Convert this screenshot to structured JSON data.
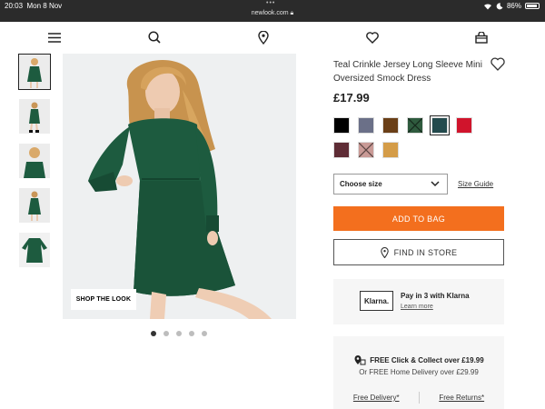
{
  "status_bar": {
    "time": "20:03",
    "date": "Mon 8 Nov",
    "url": "newlook.com",
    "battery": "86%"
  },
  "nav": {
    "icons": [
      "menu-icon",
      "search-icon",
      "location-icon",
      "heart-icon",
      "bag-icon"
    ]
  },
  "gallery": {
    "shop_the_look": "SHOP THE LOOK",
    "thumbnail_count": 5,
    "active_thumbnail": 0,
    "page_count": 5,
    "active_page": 0
  },
  "product": {
    "title": "Teal Crinkle Jersey Long Sleeve Mini Oversized Smock Dress",
    "price": "£17.99",
    "swatches": [
      {
        "color": "#000000",
        "pattern": "solid"
      },
      {
        "color": "#6b7088",
        "pattern": "solid"
      },
      {
        "color": "#6a3f17",
        "pattern": "solid"
      },
      {
        "color": "#2f5b3e",
        "pattern": "check"
      },
      {
        "color": "#234a4d",
        "pattern": "solid",
        "selected": true
      },
      {
        "color": "#d0142c",
        "pattern": "solid"
      },
      {
        "color": "#5e2c35",
        "pattern": "solid"
      },
      {
        "color": "#c99a96",
        "pattern": "check"
      },
      {
        "color": "#d49c48",
        "pattern": "solid"
      }
    ],
    "size_select": "Choose size",
    "size_guide": "Size Guide",
    "add_to_bag": "ADD TO BAG",
    "find_in_store": "FIND IN STORE"
  },
  "klarna": {
    "logo": "Klarna.",
    "headline": "Pay in 3 with Klarna",
    "link": "Learn more"
  },
  "delivery": {
    "click_collect": "FREE Click & Collect over £19.99",
    "home_delivery": "Or FREE Home Delivery over £29.99",
    "free_delivery_link": "Free Delivery*",
    "free_returns_link": "Free Returns*"
  },
  "colors": {
    "accent": "#f36f1e",
    "dress": "#1d5b3f"
  }
}
